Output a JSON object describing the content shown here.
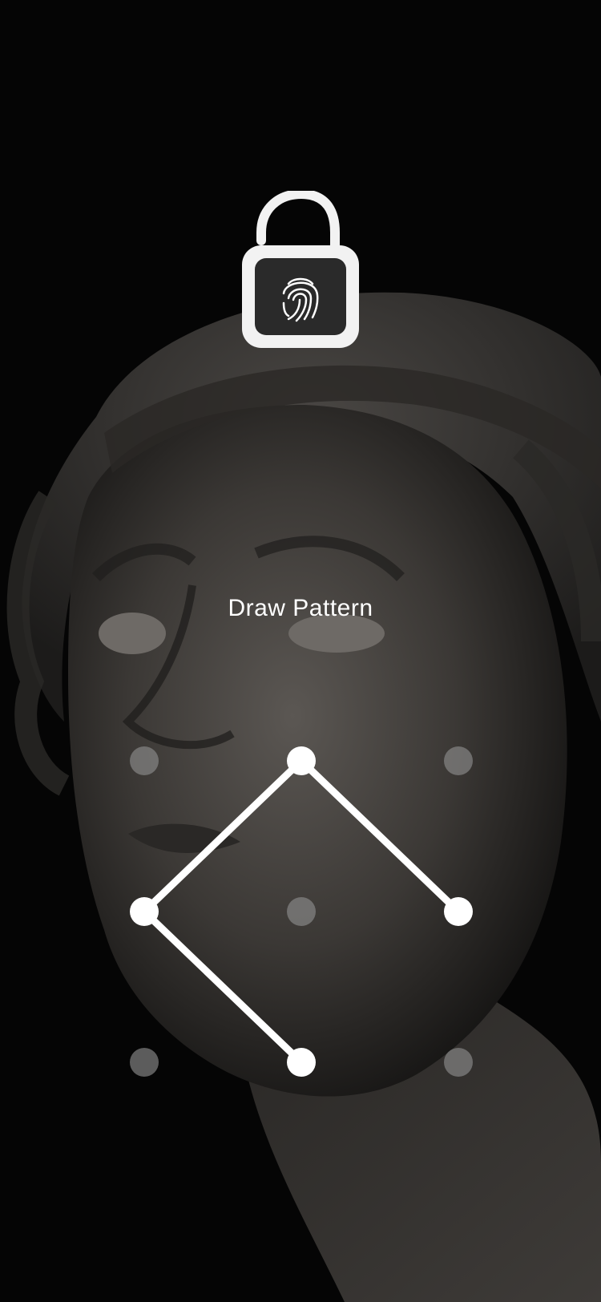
{
  "screen": {
    "title": "Draw Pattern"
  },
  "lock": {
    "icon": "unlocked-padlock-fingerprint-icon",
    "state": "unlocked"
  },
  "pattern": {
    "grid_rows": 3,
    "grid_cols": 3,
    "selected_nodes": [
      1,
      3,
      7,
      5
    ],
    "active_color": "#ffffff",
    "inactive_color": "#8c8c8c"
  },
  "colors": {
    "background": "#050505",
    "text": "#ffffff"
  }
}
